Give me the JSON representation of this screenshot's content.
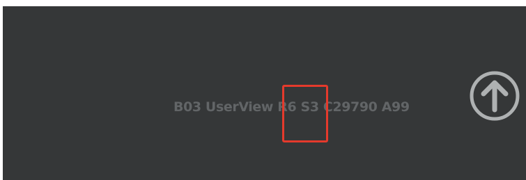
{
  "viewer": {
    "status_text": "B03 UserView R6 S3 C29790 A99"
  },
  "controls": {
    "up_button_icon": "arrow-up-circle-icon"
  },
  "annotation": {
    "highlight_color": "#e53a2c"
  },
  "colors": {
    "background": "#353738",
    "status_text": "#626567",
    "icon": "#aeb1b2"
  }
}
